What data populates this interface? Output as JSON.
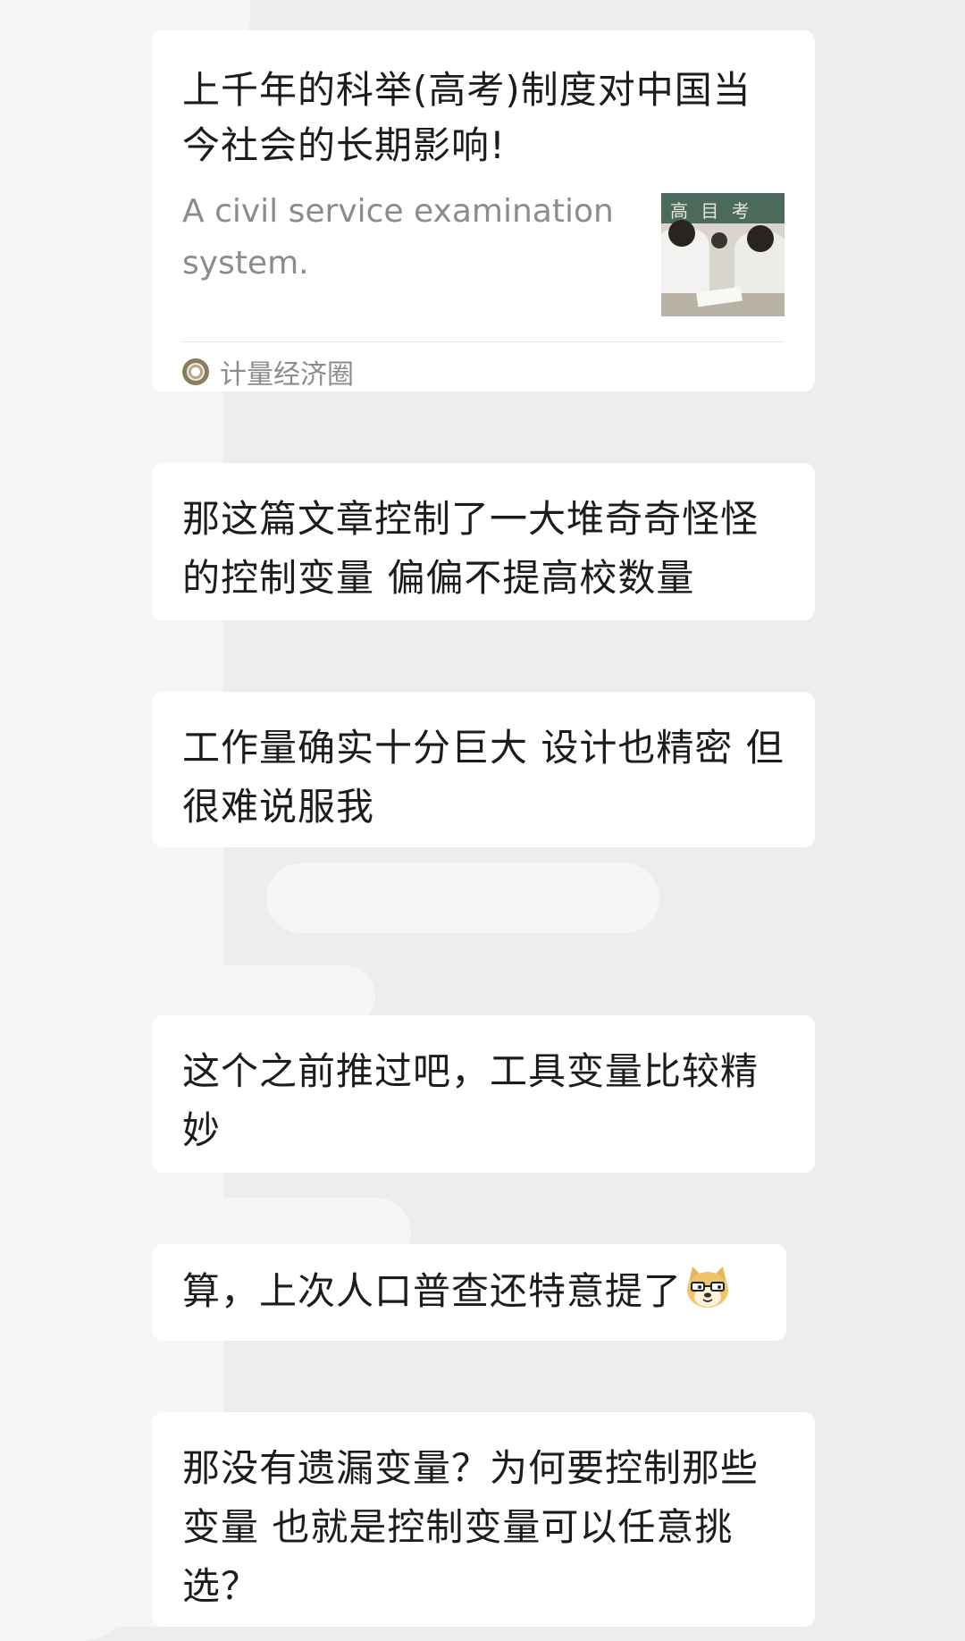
{
  "messages": [
    {
      "type": "link_card",
      "title": "上千年的科举(高考)制度对中国当今社会的长期影响!",
      "description": "A civil service examination system.",
      "thumbnail_board_text": "高 目 考",
      "source": "计量经济圈",
      "source_icon": "source-avatar-icon"
    },
    {
      "type": "text",
      "text": "那这篇文章控制了一大堆奇奇怪怪的控制变量 偏偏不提高校数量"
    },
    {
      "type": "text",
      "text": "工作量确实十分巨大 设计也精密 但很难说服我"
    },
    {
      "type": "text",
      "text": "这个之前推过吧，工具变量比较精妙"
    },
    {
      "type": "text",
      "text": "算，上次人口普查还特意提了",
      "emoji": "doge-emoji-icon"
    },
    {
      "type": "text",
      "text": "那没有遗漏变量？为何要控制那些变量 也就是控制变量可以任意挑选？"
    }
  ]
}
